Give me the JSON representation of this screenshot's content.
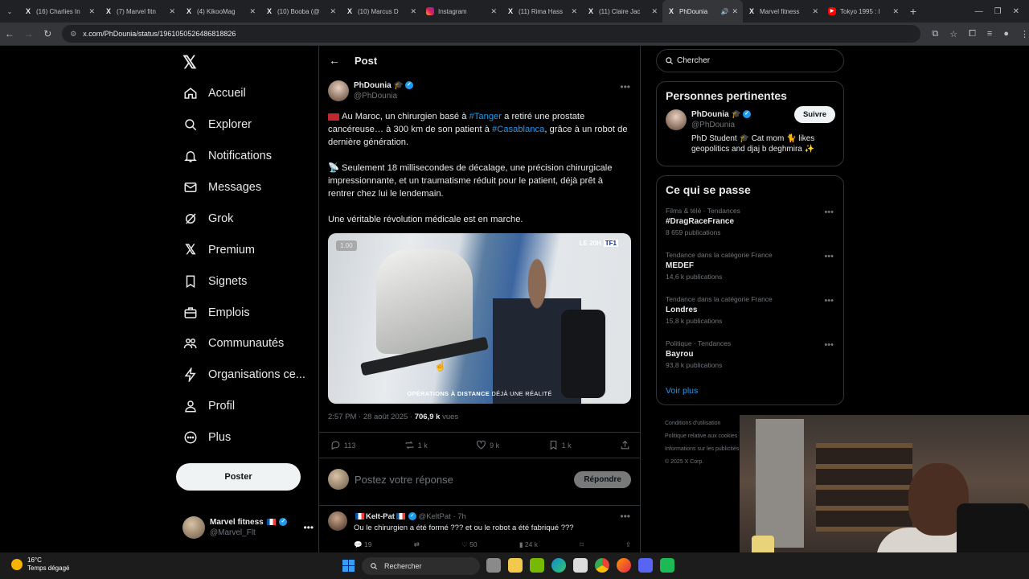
{
  "browser": {
    "tabs": [
      {
        "title": "(16) Charlies In",
        "icon": "x-icon",
        "active": false
      },
      {
        "title": "(7) Marvel fitn",
        "icon": "x-icon",
        "active": false
      },
      {
        "title": "(4) KikooMag",
        "icon": "x-icon",
        "active": false
      },
      {
        "title": "(10) Booba (@",
        "icon": "x-icon",
        "active": false
      },
      {
        "title": "(10) Marcus D",
        "icon": "x-icon",
        "active": false
      },
      {
        "title": "Instagram",
        "icon": "instagram-icon",
        "active": false
      },
      {
        "title": "(11) Rima Hass",
        "icon": "x-icon",
        "active": false
      },
      {
        "title": "(11) Claire Jac",
        "icon": "x-icon",
        "active": false
      },
      {
        "title": "PhDounia",
        "icon": "x-icon",
        "active": true
      },
      {
        "title": "Marvel fitness",
        "icon": "x-icon",
        "active": false
      },
      {
        "title": "Tokyo 1995 : l",
        "icon": "youtube-icon",
        "active": false
      }
    ],
    "url": "x.com/PhDounia/status/1961050526486818826"
  },
  "nav": {
    "items": [
      {
        "label": "Accueil",
        "icon": "home-icon"
      },
      {
        "label": "Explorer",
        "icon": "search-icon"
      },
      {
        "label": "Notifications",
        "icon": "bell-icon"
      },
      {
        "label": "Messages",
        "icon": "mail-icon"
      },
      {
        "label": "Grok",
        "icon": "grok-icon"
      },
      {
        "label": "Premium",
        "icon": "x-logo-icon"
      },
      {
        "label": "Signets",
        "icon": "bookmark-icon"
      },
      {
        "label": "Emplois",
        "icon": "briefcase-icon"
      },
      {
        "label": "Communautés",
        "icon": "people-icon"
      },
      {
        "label": "Organisations ce...",
        "icon": "lightning-icon"
      },
      {
        "label": "Profil",
        "icon": "person-icon"
      },
      {
        "label": "Plus",
        "icon": "more-circle-icon"
      }
    ],
    "post_button": "Poster",
    "account": {
      "name": "Marvel fitness",
      "handle": "@Marvel_Flt"
    }
  },
  "post": {
    "header": "Post",
    "author": {
      "name": "PhDounia",
      "handle": "@PhDounia"
    },
    "text": {
      "p1_pre": "Au Maroc, un chirurgien basé à ",
      "p1_tag1": "#Tanger",
      "p1_mid": " a retiré une prostate cancéreuse… à 300 km de son patient à ",
      "p1_tag2": "#Casablanca",
      "p1_post": ", grâce à un robot de dernière génération.",
      "p2": "Seulement 18 millisecondes de décalage, une précision chirurgicale impressionnante, et un traumatisme réduit pour le patient, déjà prêt à rentrer chez lui le lendemain.",
      "p3": "Une véritable révolution médicale est en marche."
    },
    "video": {
      "speed": "1.00",
      "channel_prefix": "LE 20H",
      "channel": "TF1",
      "caption_bold": "OPÉRATIONS À DISTANCE",
      "caption_rest": " DÉJÀ UNE RÉALITÉ"
    },
    "meta": {
      "time": "2:57 PM · 28 août 2025 · ",
      "views": "706,9 k",
      "views_label": " vues"
    },
    "stats": {
      "replies": "113",
      "reposts": "1 k",
      "likes": "9 k",
      "bookmarks": "1 k"
    },
    "reply_placeholder": "Postez votre réponse",
    "reply_button": "Répondre"
  },
  "reply": {
    "name": "Kelt-Pat",
    "handle": "@KeltPat · 7h",
    "text": "Ou le chirurgien a été formé ??? et ou le robot a été fabriqué ???",
    "replies": "19",
    "likes": "50",
    "views": "24 k"
  },
  "sidebar": {
    "search_placeholder": "Chercher",
    "relevant_title": "Personnes pertinentes",
    "relevant_user": {
      "name": "PhDounia",
      "handle": "@PhDounia",
      "bio": "PhD Student 🎓 Cat mom 🐈 likes geopolitics and djaj b deghmira ✨",
      "follow": "Suivre"
    },
    "trends_title": "Ce qui se passe",
    "trends": [
      {
        "meta": "Films & télé · Tendances",
        "name": "#DragRaceFrance",
        "count": "8 659 publications"
      },
      {
        "meta": "Tendance dans la catégorie France",
        "name": "MEDEF",
        "count": "14,6 k publications"
      },
      {
        "meta": "Tendance dans la catégorie France",
        "name": "Londres",
        "count": "15,8 k publications"
      },
      {
        "meta": "Politique · Tendances",
        "name": "Bayrou",
        "count": "93,8 k publications"
      }
    ],
    "see_more": "Voir plus",
    "footer": [
      "Conditions d'utilisation",
      "Politique relative aux cookies",
      "Informations sur les publicités",
      "© 2025 X Corp."
    ]
  },
  "taskbar": {
    "temp": "16°C",
    "weather": "Temps dégagé",
    "search": "Rechercher"
  }
}
